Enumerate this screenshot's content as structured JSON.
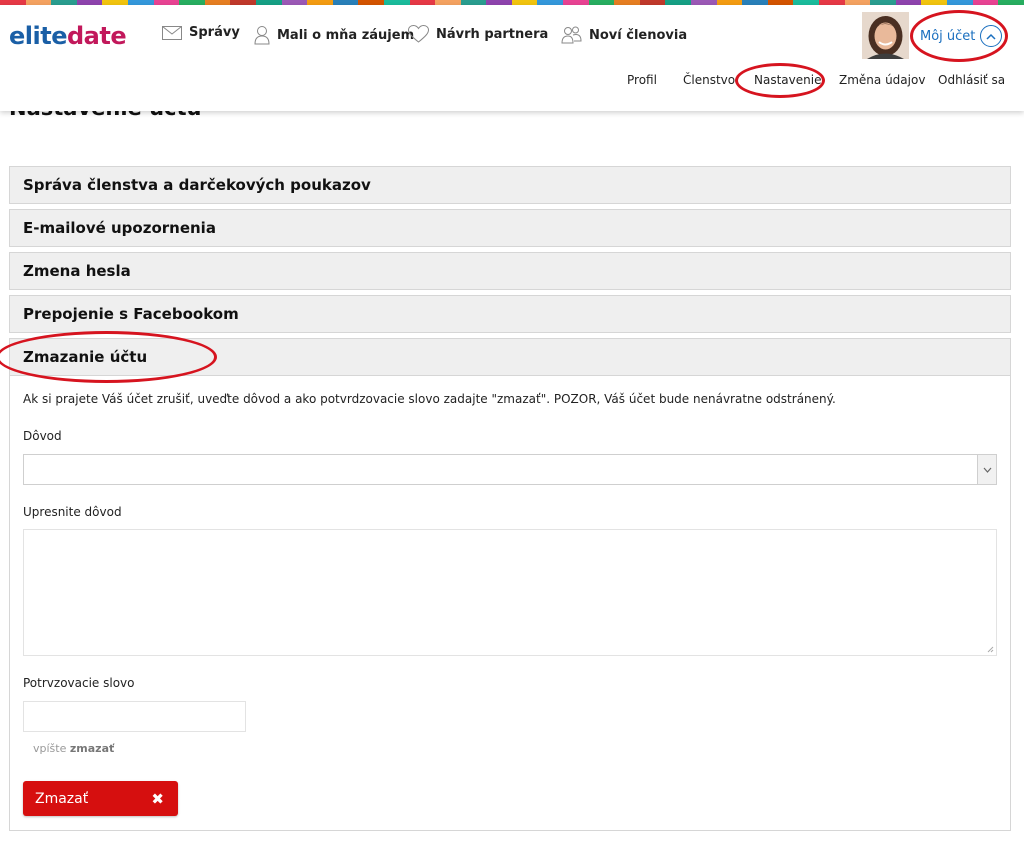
{
  "brand": {
    "logo_part1": "elite",
    "logo_part2": "date"
  },
  "nav": {
    "messages": "Správy",
    "interested": "Mali o mňa záujem",
    "suggestion": "Návrh partnera",
    "new_members": "Noví členovia",
    "account": "Môj účet"
  },
  "subnav": {
    "profile": "Profil",
    "membership": "Členstvo",
    "settings": "Nastavenie",
    "change_details": "Změna údajov",
    "logout": "Odhlásiť sa"
  },
  "page": {
    "title": "Nastavenie účtu"
  },
  "accordion": {
    "item1": "Správa členstva a darčekových poukazov",
    "item2": "E-mailové upozornenia",
    "item3": "Zmena hesla",
    "item4": "Prepojenie s Facebookom",
    "item5": "Zmazanie účtu"
  },
  "delete_account": {
    "description": "Ak si prajete Váš účet zrušiť, uveďte dôvod a ako potvrdzovacie slovo zadajte \"zmazať\". POZOR, Váš účet bude nenávratne odstránený.",
    "reason_label": "Dôvod",
    "reason_value": "",
    "specify_label": "Upresnite dôvod",
    "confirm_label": "Potrvzovacie slovo",
    "hint_prefix": "vpíšte",
    "hint_word": "zmazať",
    "button_label": "Zmazať",
    "button_icon": "✖"
  },
  "colors": {
    "brand_blue": "#1a5fa6",
    "brand_magenta": "#c2185b",
    "link_blue": "#1a6fbf",
    "danger_red": "#d60f0f",
    "annotation_red": "#d6141f"
  }
}
